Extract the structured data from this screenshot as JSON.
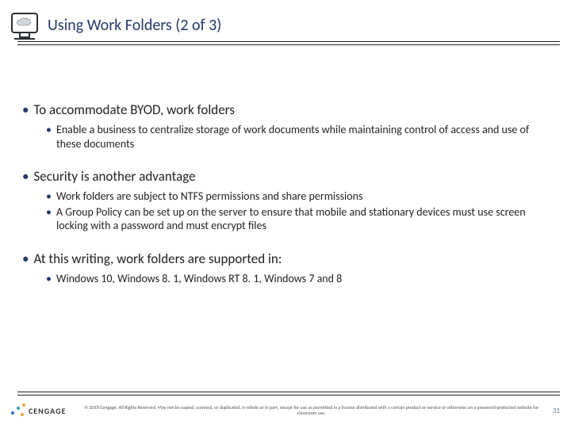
{
  "header": {
    "title": "Using Work Folders (2 of 3)",
    "icon": "cloud-monitor-icon"
  },
  "body": {
    "bullets": [
      {
        "text": "To accommodate BYOD, work folders",
        "sub": [
          "Enable a business to centralize storage of work documents while maintaining control of access and use of these documents"
        ]
      },
      {
        "text": "Security is another advantage",
        "sub": [
          "Work folders are subject to NTFS permissions and share permissions",
          "A Group Policy can be set up on the server to ensure that mobile and stationary devices must use screen locking with a password and must encrypt files"
        ]
      },
      {
        "text": "At this writing, work folders are supported in:",
        "sub": [
          "Windows 10, Windows 8. 1, Windows RT 8. 1, Windows 7 and 8"
        ]
      }
    ]
  },
  "footer": {
    "logo_text": "CENGAGE",
    "copyright": "© 2018 Cengage. All Rights Reserved. May not be copied, scanned, or duplicated, in whole or in part, except for use as permitted in a license distributed with a certain product or service or otherwise on a password-protected website for classroom use.",
    "page_number": "31"
  }
}
